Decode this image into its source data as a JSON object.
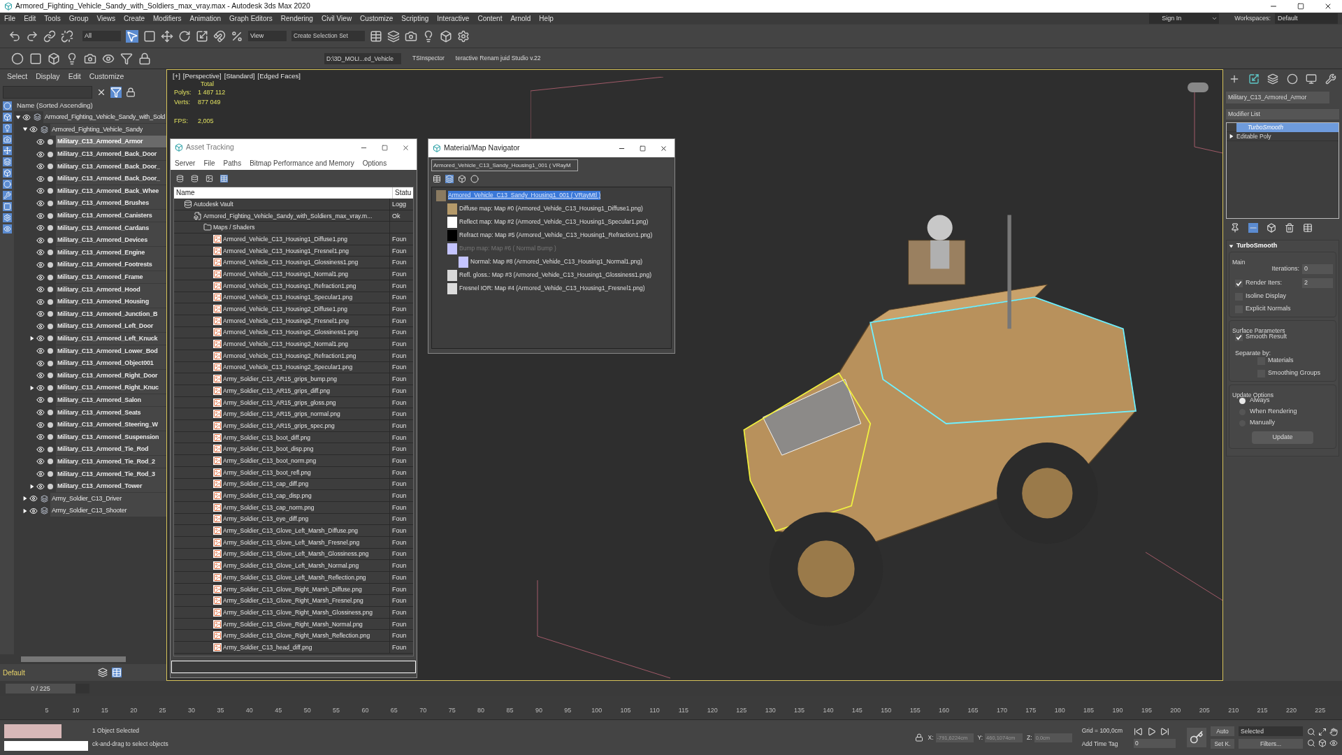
{
  "window": {
    "title": "Armored_Fighting_Vehicle_Sandy_with_Soldiers_max_vray.max - Autodesk 3ds Max 2020"
  },
  "menu": [
    "File",
    "Edit",
    "Tools",
    "Group",
    "Views",
    "Create",
    "Modifiers",
    "Animation",
    "Graph Editors",
    "Rendering",
    "Civil View",
    "Customize",
    "Scripting",
    "Interactive",
    "Content",
    "Arnold",
    "Help"
  ],
  "account": {
    "sign_in": "Sign In",
    "workspaces_label": "Workspaces:",
    "workspace": "Default"
  },
  "toolbar": {
    "selection_filter": "All",
    "reference_coord": "View",
    "selection_set_placeholder": "Create Selection Set",
    "project_path": "D:\\3D_MOLI...ed_Vehicle",
    "plugins": [
      "TSInspector",
      "teractive Renam juid Studio v.22"
    ]
  },
  "scene_explorer": {
    "menu": [
      "Select",
      "Display",
      "Edit",
      "Customize"
    ],
    "column": "Name (Sorted Ascending)",
    "tree": [
      {
        "name": "Armored_Fighting_Vehicle_Sandy_with_Sold",
        "expanded": true,
        "selected": false,
        "children": [
          {
            "name": "Armored_Fighting_Vehicle_Sandy",
            "expanded": true,
            "selected": false,
            "children": [
              {
                "name": "Military_C13_Armored_Armor",
                "selected": true
              },
              {
                "name": "Military_C13_Armored_Back_Door",
                "selected": false
              },
              {
                "name": "Military_C13_Armored_Back_Door_",
                "selected": false
              },
              {
                "name": "Military_C13_Armored_Back_Door_",
                "selected": false
              },
              {
                "name": "Military_C13_Armored_Back_Whee",
                "selected": false
              },
              {
                "name": "Military_C13_Armored_Brushes",
                "selected": false
              },
              {
                "name": "Military_C13_Armored_Canisters",
                "selected": false
              },
              {
                "name": "Military_C13_Armored_Cardans",
                "selected": false
              },
              {
                "name": "Military_C13_Armored_Devices",
                "selected": false
              },
              {
                "name": "Military_C13_Armored_Engine",
                "selected": false
              },
              {
                "name": "Military_C13_Armored_Footrests",
                "selected": false
              },
              {
                "name": "Military_C13_Armored_Frame",
                "selected": false
              },
              {
                "name": "Military_C13_Armored_Hood",
                "selected": false
              },
              {
                "name": "Military_C13_Armored_Housing",
                "selected": false
              },
              {
                "name": "Military_C13_Armored_Junction_B",
                "selected": false
              },
              {
                "name": "Military_C13_Armored_Left_Door",
                "selected": false
              },
              {
                "name": "Military_C13_Armored_Left_Knuck",
                "expanded": false,
                "selected": false
              },
              {
                "name": "Military_C13_Armored_Lower_Bod",
                "selected": false
              },
              {
                "name": "Military_C13_Armored_Object001",
                "selected": false
              },
              {
                "name": "Military_C13_Armored_Right_Door",
                "selected": false
              },
              {
                "name": "Military_C13_Armored_Right_Knuc",
                "expanded": false,
                "selected": false
              },
              {
                "name": "Military_C13_Armored_Salon",
                "selected": false
              },
              {
                "name": "Military_C13_Armored_Seats",
                "selected": false
              },
              {
                "name": "Military_C13_Armored_Steering_W",
                "selected": false
              },
              {
                "name": "Military_C13_Armored_Suspension",
                "selected": false
              },
              {
                "name": "Military_C13_Armored_Tie_Rod",
                "selected": false
              },
              {
                "name": "Military_C13_Armored_Tie_Rod_2",
                "selected": false
              },
              {
                "name": "Military_C13_Armored_Tie_Rod_3",
                "selected": false
              },
              {
                "name": "Military_C13_Armored_Tower",
                "expanded": false,
                "selected": false
              }
            ]
          },
          {
            "name": "Army_Soldier_C13_Driver",
            "expanded": false,
            "selected": false
          },
          {
            "name": "Army_Soldier_C13_Shooter",
            "expanded": false,
            "selected": false
          }
        ]
      }
    ],
    "layer": "Default",
    "frame_counter": "0 / 225",
    "frame_slider": {
      "level": 0
    }
  },
  "viewport": {
    "labels": [
      "[+]",
      "[Perspective]",
      "[Standard]",
      "[Edged Faces]"
    ],
    "stats_title": "Total",
    "stats": [
      {
        "label": "Polys:",
        "value": "1 487 112"
      },
      {
        "label": "Verts:",
        "value": "877 049"
      }
    ],
    "fps_label": "FPS:",
    "fps": "2,005"
  },
  "asset_tracking": {
    "title": "Asset Tracking",
    "menu": [
      "Server",
      "File",
      "Paths",
      "Bitmap Performance and Memory",
      "Options"
    ],
    "columns": [
      "Name",
      "Statu"
    ],
    "rows": [
      {
        "name": "Autodesk Vault",
        "status": "Logg",
        "kind": "vault",
        "children": [
          {
            "name": "Armored_Fighting_Vehicle_Sandy_with_Soldiers_max_vray.m...",
            "status": "Ok",
            "kind": "scene",
            "children": [
              {
                "name": "Maps / Shaders",
                "kind": "folder",
                "children": [
                  {
                    "name": "Armored_Vehicle_C13_Housing1_Diffuse1.png",
                    "status": "Foun",
                    "kind": "bitmap"
                  },
                  {
                    "name": "Armored_Vehicle_C13_Housing1_Fresnel1.png",
                    "status": "Foun",
                    "kind": "bitmap"
                  },
                  {
                    "name": "Armored_Vehicle_C13_Housing1_Glossiness1.png",
                    "status": "Foun",
                    "kind": "bitmap"
                  },
                  {
                    "name": "Armored_Vehicle_C13_Housing1_Normal1.png",
                    "status": "Foun",
                    "kind": "bitmap"
                  },
                  {
                    "name": "Armored_Vehicle_C13_Housing1_Refraction1.png",
                    "status": "Foun",
                    "kind": "bitmap"
                  },
                  {
                    "name": "Armored_Vehicle_C13_Housing1_Specular1.png",
                    "status": "Foun",
                    "kind": "bitmap"
                  },
                  {
                    "name": "Armored_Vehicle_C13_Housing2_Diffuse1.png",
                    "status": "Foun",
                    "kind": "bitmap"
                  },
                  {
                    "name": "Armored_Vehicle_C13_Housing2_Fresnel1.png",
                    "status": "Foun",
                    "kind": "bitmap"
                  },
                  {
                    "name": "Armored_Vehicle_C13_Housing2_Glossiness1.png",
                    "status": "Foun",
                    "kind": "bitmap"
                  },
                  {
                    "name": "Armored_Vehicle_C13_Housing2_Normal1.png",
                    "status": "Foun",
                    "kind": "bitmap"
                  },
                  {
                    "name": "Armored_Vehicle_C13_Housing2_Refraction1.png",
                    "status": "Foun",
                    "kind": "bitmap"
                  },
                  {
                    "name": "Armored_Vehicle_C13_Housing2_Specular1.png",
                    "status": "Foun",
                    "kind": "bitmap"
                  },
                  {
                    "name": "Army_Soldier_C13_AR15_grips_bump.png",
                    "status": "Foun",
                    "kind": "bitmap"
                  },
                  {
                    "name": "Army_Soldier_C13_AR15_grips_diff.png",
                    "status": "Foun",
                    "kind": "bitmap"
                  },
                  {
                    "name": "Army_Soldier_C13_AR15_grips_gloss.png",
                    "status": "Foun",
                    "kind": "bitmap"
                  },
                  {
                    "name": "Army_Soldier_C13_AR15_grips_normal.png",
                    "status": "Foun",
                    "kind": "bitmap"
                  },
                  {
                    "name": "Army_Soldier_C13_AR15_grips_spec.png",
                    "status": "Foun",
                    "kind": "bitmap"
                  },
                  {
                    "name": "Army_Soldier_C13_boot_diff.png",
                    "status": "Foun",
                    "kind": "bitmap"
                  },
                  {
                    "name": "Army_Soldier_C13_boot_disp.png",
                    "status": "Foun",
                    "kind": "bitmap"
                  },
                  {
                    "name": "Army_Soldier_C13_boot_norm.png",
                    "status": "Foun",
                    "kind": "bitmap"
                  },
                  {
                    "name": "Army_Soldier_C13_boot_refl.png",
                    "status": "Foun",
                    "kind": "bitmap"
                  },
                  {
                    "name": "Army_Soldier_C13_cap_diff.png",
                    "status": "Foun",
                    "kind": "bitmap"
                  },
                  {
                    "name": "Army_Soldier_C13_cap_disp.png",
                    "status": "Foun",
                    "kind": "bitmap"
                  },
                  {
                    "name": "Army_Soldier_C13_cap_norm.png",
                    "status": "Foun",
                    "kind": "bitmap"
                  },
                  {
                    "name": "Army_Soldier_C13_eye_diff.png",
                    "status": "Foun",
                    "kind": "bitmap"
                  },
                  {
                    "name": "Army_Soldier_C13_Glove_Left_Marsh_Diffuse.png",
                    "status": "Foun",
                    "kind": "bitmap"
                  },
                  {
                    "name": "Army_Soldier_C13_Glove_Left_Marsh_Fresnel.png",
                    "status": "Foun",
                    "kind": "bitmap"
                  },
                  {
                    "name": "Army_Soldier_C13_Glove_Left_Marsh_Glossiness.png",
                    "status": "Foun",
                    "kind": "bitmap"
                  },
                  {
                    "name": "Army_Soldier_C13_Glove_Left_Marsh_Normal.png",
                    "status": "Foun",
                    "kind": "bitmap"
                  },
                  {
                    "name": "Army_Soldier_C13_Glove_Left_Marsh_Reflection.png",
                    "status": "Foun",
                    "kind": "bitmap"
                  },
                  {
                    "name": "Army_Soldier_C13_Glove_Right_Marsh_Diffuse.png",
                    "status": "Foun",
                    "kind": "bitmap"
                  },
                  {
                    "name": "Army_Soldier_C13_Glove_Right_Marsh_Fresnel.png",
                    "status": "Foun",
                    "kind": "bitmap"
                  },
                  {
                    "name": "Army_Soldier_C13_Glove_Right_Marsh_Glossiness.png",
                    "status": "Foun",
                    "kind": "bitmap"
                  },
                  {
                    "name": "Army_Soldier_C13_Glove_Right_Marsh_Normal.png",
                    "status": "Foun",
                    "kind": "bitmap"
                  },
                  {
                    "name": "Army_Soldier_C13_Glove_Right_Marsh_Reflection.png",
                    "status": "Foun",
                    "kind": "bitmap"
                  },
                  {
                    "name": "Army_Soldier_C13_head_diff.png",
                    "status": "Foun",
                    "kind": "bitmap"
                  }
                ]
              }
            ]
          }
        ]
      }
    ]
  },
  "material_navigator": {
    "title": "Material/Map Navigator",
    "material_field": "Armored_Vehicle_C13_Sandy_Housing1_001  ( VRayM",
    "tree": [
      {
        "label": "Armored_Vehicle_C13_Sandy_Housing1_001  ( VRayMtl )",
        "color": "#8a7a60",
        "selected": true,
        "disabled": false,
        "children": [
          {
            "label": "Diffuse map: Map #0 (Armored_Vehide_C13_Housing1_Diffuse1.png)",
            "color": "#b59a6a",
            "selected": false,
            "disabled": false
          },
          {
            "label": "Reflect map: Map #2 (Armored_Vehide_C13_Housing1_Specular1.png)",
            "color": "#ffffff",
            "selected": false,
            "disabled": false
          },
          {
            "label": "Refract map: Map #5 (Armored_Vehide_C13_Housing1_Refraction1.png)",
            "color": "#000000",
            "selected": false,
            "disabled": false
          },
          {
            "label": "Bump map: Map #6  ( Normal Bump )",
            "color": "#c4c4ff",
            "selected": false,
            "disabled": true,
            "children": [
              {
                "label": "Normal: Map #8 (Armored_Vehide_C13_Housing1_Normal1.png)",
                "color": "#c4c4ff",
                "selected": false,
                "disabled": false
              }
            ]
          },
          {
            "label": "Refl. gloss.: Map #3 (Armored_Vehide_C13_Housing1_Glossiness1.png)",
            "color": "#d8d8d8",
            "selected": false,
            "disabled": false
          },
          {
            "label": "Fresnel IOR: Map #4 (Armored_Vehide_C13_Housing1_Fresnel1.png)",
            "color": "#dcdcdc",
            "selected": false,
            "disabled": false
          }
        ]
      }
    ]
  },
  "command_panel": {
    "object_name": "Military_C13_Armored_Armor",
    "modifier_list": "Modifier List",
    "stack": [
      {
        "name": "TurboSmooth",
        "selected": true
      },
      {
        "name": "Editable Poly",
        "selected": false,
        "expanded": false
      }
    ],
    "rollout": {
      "title": "TurboSmooth",
      "groups": [
        {
          "title": "Main",
          "controls": [
            {
              "kind": "spinner",
              "label": "Iterations:",
              "value": "0"
            },
            {
              "kind": "check_spinner",
              "label": "Render Iters:",
              "checked": true,
              "value": "2"
            },
            {
              "kind": "checkbox",
              "label": "Isoline Display",
              "checked": false
            },
            {
              "kind": "checkbox",
              "label": "Explicit Normals",
              "checked": false
            }
          ]
        },
        {
          "title": "Surface Parameters",
          "controls": [
            {
              "kind": "checkbox",
              "label": "Smooth Result",
              "checked": true
            },
            {
              "kind": "text",
              "label": "Separate by:"
            },
            {
              "kind": "subcheckbox",
              "label": "Materials",
              "checked": false
            },
            {
              "kind": "subcheckbox",
              "label": "Smoothing Groups",
              "checked": false
            }
          ]
        },
        {
          "title": "Update Options",
          "controls": [
            {
              "kind": "radio",
              "label": "Always",
              "selected": true
            },
            {
              "kind": "radio",
              "label": "When Rendering",
              "selected": false
            },
            {
              "kind": "radio",
              "label": "Manually",
              "selected": false
            },
            {
              "kind": "button",
              "label": "Update"
            }
          ]
        }
      ]
    }
  },
  "timeline": {
    "ticks": [
      "5",
      "10",
      "15",
      "20",
      "25",
      "30",
      "35",
      "40",
      "45",
      "50",
      "55",
      "60",
      "65",
      "70",
      "75",
      "80",
      "85",
      "90",
      "95",
      "100",
      "105",
      "110",
      "115",
      "120",
      "125",
      "130",
      "135",
      "140",
      "145",
      "150",
      "155",
      "160",
      "165",
      "170",
      "175",
      "180",
      "185",
      "190",
      "195",
      "200",
      "205",
      "210",
      "215",
      "220",
      "225"
    ]
  },
  "status_bar": {
    "selection": "1 Object Selected",
    "prompt": "ck-and-drag to select objects",
    "x_label": "X:",
    "x": "-791,6224cm",
    "y_label": "Y:",
    "y": "460,1074cm",
    "z_label": "Z:",
    "z": "0,0cm",
    "grid": "Grid = 100,0cm",
    "add_time_tag": "Add Time Tag",
    "auto_key": "Auto",
    "key_filter": "Selected",
    "set_key": "Set K.",
    "filters": "Filters...",
    "frame": "0"
  }
}
